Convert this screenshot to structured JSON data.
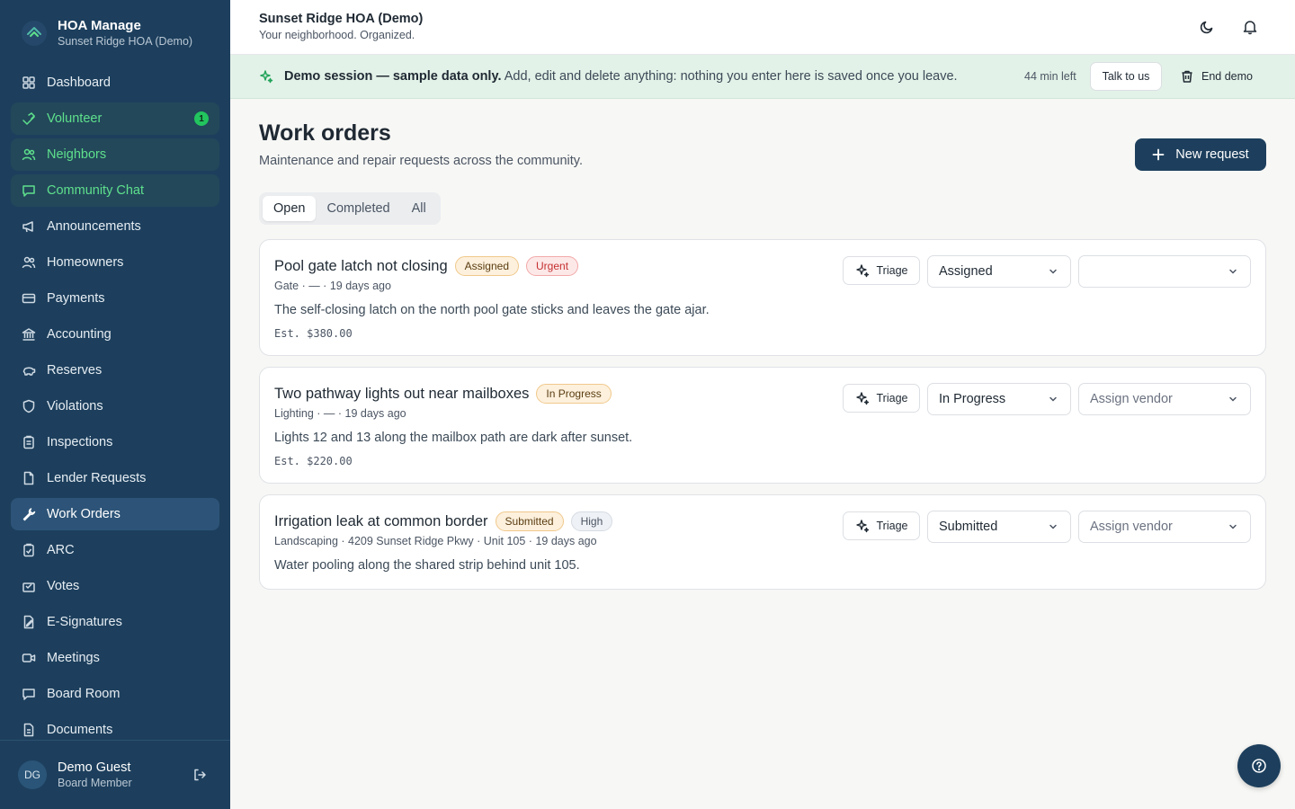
{
  "app": {
    "name": "HOA Manage",
    "org": "Sunset Ridge HOA (Demo)"
  },
  "sidebar": {
    "items": [
      {
        "label": "Dashboard",
        "icon": "dashboard-icon"
      },
      {
        "label": "Volunteer",
        "icon": "volunteer-icon",
        "badge": "1"
      },
      {
        "label": "Neighbors",
        "icon": "neighbors-icon"
      },
      {
        "label": "Community Chat",
        "icon": "chat-icon"
      },
      {
        "label": "Announcements",
        "icon": "megaphone-icon"
      },
      {
        "label": "Homeowners",
        "icon": "homeowners-icon"
      },
      {
        "label": "Payments",
        "icon": "credit-card-icon"
      },
      {
        "label": "Accounting",
        "icon": "bank-icon"
      },
      {
        "label": "Reserves",
        "icon": "piggy-bank-icon"
      },
      {
        "label": "Violations",
        "icon": "shield-icon"
      },
      {
        "label": "Inspections",
        "icon": "clipboard-list-icon"
      },
      {
        "label": "Lender Requests",
        "icon": "file-icon"
      },
      {
        "label": "Work Orders",
        "icon": "wrench-icon"
      },
      {
        "label": "ARC",
        "icon": "clipboard-check-icon"
      },
      {
        "label": "Votes",
        "icon": "ballot-icon"
      },
      {
        "label": "E-Signatures",
        "icon": "signature-icon"
      },
      {
        "label": "Meetings",
        "icon": "video-icon"
      },
      {
        "label": "Board Room",
        "icon": "board-room-icon"
      },
      {
        "label": "Documents",
        "icon": "document-icon"
      }
    ],
    "user": {
      "initials": "DG",
      "name": "Demo Guest",
      "role": "Board Member"
    }
  },
  "header": {
    "title": "Sunset Ridge HOA (Demo)",
    "subtitle": "Your neighborhood. Organized."
  },
  "banner": {
    "bold": "Demo session — sample data only.",
    "text": " Add, edit and delete anything: nothing you enter here is saved once you leave.",
    "time_left": "44 min left",
    "talk_label": "Talk to us",
    "end_label": "End demo"
  },
  "main": {
    "title": "Work orders",
    "subtitle": "Maintenance and repair requests across the community.",
    "new_button": "New request",
    "tabs": [
      "Open",
      "Completed",
      "All"
    ],
    "triage_label": "Triage",
    "orders": [
      {
        "title": "Pool gate latch not closing",
        "status_badge": "Assigned",
        "priority_badge": "Urgent",
        "meta": "Gate · — · 19 days ago",
        "description": "The self-closing latch on the north pool gate sticks and leaves the gate ajar.",
        "estimate": "Est. $380.00",
        "status": "Assigned",
        "vendor": ""
      },
      {
        "title": "Two pathway lights out near mailboxes",
        "status_badge": "In Progress",
        "meta": "Lighting · — · 19 days ago",
        "description": "Lights 12 and 13 along the mailbox path are dark after sunset.",
        "estimate": "Est. $220.00",
        "status": "In Progress",
        "vendor": "Assign vendor"
      },
      {
        "title": "Irrigation leak at common border",
        "status_badge": "Submitted",
        "priority_badge": "High",
        "meta": "Landscaping · 4209 Sunset Ridge Pkwy · Unit 105 · 19 days ago",
        "description": "Water pooling along the shared strip behind unit 105.",
        "status": "Submitted",
        "vendor": "Assign vendor"
      }
    ]
  },
  "colors": {
    "sidebar_bg": "#1d3f5d",
    "accent_green": "#22c55e",
    "primary_button": "#1d3f5d",
    "banner_bg": "#e3f2e8"
  }
}
